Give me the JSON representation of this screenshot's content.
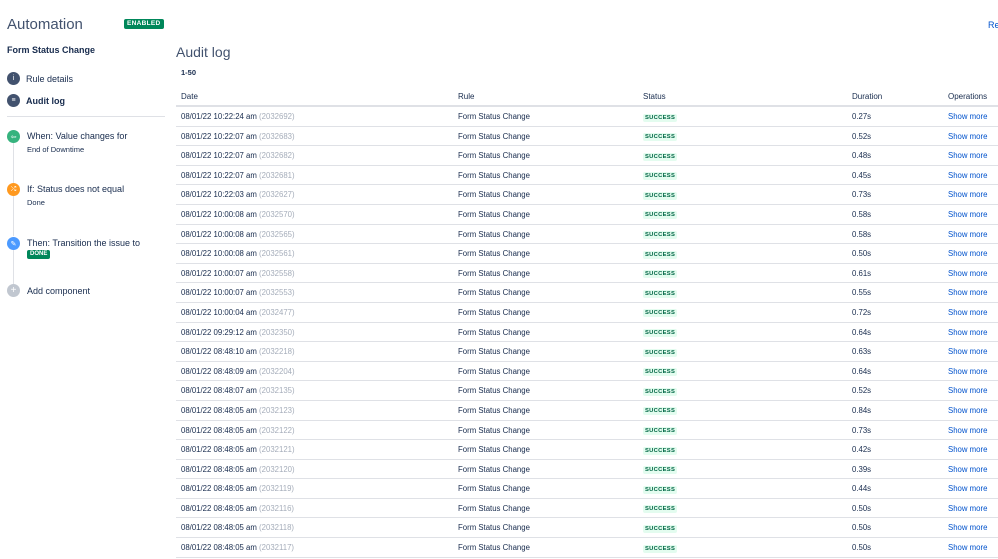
{
  "header": {
    "title": "Automation",
    "status_badge": "ENABLED",
    "right_link": "Re"
  },
  "rule_name": "Form Status Change",
  "nav": [
    {
      "label": "Rule details",
      "icon": "info-icon"
    },
    {
      "label": "Audit log",
      "icon": "audit-log-icon"
    }
  ],
  "components": [
    {
      "title": "When: Value changes for",
      "sub": "End of Downtime",
      "icon": "trigger-icon",
      "color": "#36b37e"
    },
    {
      "title": "If: Status does not equal",
      "sub": "Done",
      "icon": "condition-icon",
      "color": "#ff991f"
    },
    {
      "title": "Then: Transition the issue to",
      "badge": "DONE",
      "icon": "action-icon",
      "color": "#4c9aff"
    }
  ],
  "add_component": "Add component",
  "audit": {
    "title": "Audit log",
    "range": "1-50",
    "columns": {
      "date": "Date",
      "rule": "Rule",
      "status": "Status",
      "duration": "Duration",
      "operations": "Operations"
    },
    "rows": [
      {
        "date": "08/01/22 10:22:24 am",
        "id": "(2032692)",
        "rule": "Form Status Change",
        "status": "SUCCESS",
        "duration": "0.27s",
        "op": "Show more"
      },
      {
        "date": "08/01/22 10:22:07 am",
        "id": "(2032683)",
        "rule": "Form Status Change",
        "status": "SUCCESS",
        "duration": "0.52s",
        "op": "Show more"
      },
      {
        "date": "08/01/22 10:22:07 am",
        "id": "(2032682)",
        "rule": "Form Status Change",
        "status": "SUCCESS",
        "duration": "0.48s",
        "op": "Show more"
      },
      {
        "date": "08/01/22 10:22:07 am",
        "id": "(2032681)",
        "rule": "Form Status Change",
        "status": "SUCCESS",
        "duration": "0.45s",
        "op": "Show more"
      },
      {
        "date": "08/01/22 10:22:03 am",
        "id": "(2032627)",
        "rule": "Form Status Change",
        "status": "SUCCESS",
        "duration": "0.73s",
        "op": "Show more"
      },
      {
        "date": "08/01/22 10:00:08 am",
        "id": "(2032570)",
        "rule": "Form Status Change",
        "status": "SUCCESS",
        "duration": "0.58s",
        "op": "Show more"
      },
      {
        "date": "08/01/22 10:00:08 am",
        "id": "(2032565)",
        "rule": "Form Status Change",
        "status": "SUCCESS",
        "duration": "0.58s",
        "op": "Show more"
      },
      {
        "date": "08/01/22 10:00:08 am",
        "id": "(2032561)",
        "rule": "Form Status Change",
        "status": "SUCCESS",
        "duration": "0.50s",
        "op": "Show more"
      },
      {
        "date": "08/01/22 10:00:07 am",
        "id": "(2032558)",
        "rule": "Form Status Change",
        "status": "SUCCESS",
        "duration": "0.61s",
        "op": "Show more"
      },
      {
        "date": "08/01/22 10:00:07 am",
        "id": "(2032553)",
        "rule": "Form Status Change",
        "status": "SUCCESS",
        "duration": "0.55s",
        "op": "Show more"
      },
      {
        "date": "08/01/22 10:00:04 am",
        "id": "(2032477)",
        "rule": "Form Status Change",
        "status": "SUCCESS",
        "duration": "0.72s",
        "op": "Show more"
      },
      {
        "date": "08/01/22 09:29:12 am",
        "id": "(2032350)",
        "rule": "Form Status Change",
        "status": "SUCCESS",
        "duration": "0.64s",
        "op": "Show more"
      },
      {
        "date": "08/01/22 08:48:10 am",
        "id": "(2032218)",
        "rule": "Form Status Change",
        "status": "SUCCESS",
        "duration": "0.63s",
        "op": "Show more"
      },
      {
        "date": "08/01/22 08:48:09 am",
        "id": "(2032204)",
        "rule": "Form Status Change",
        "status": "SUCCESS",
        "duration": "0.64s",
        "op": "Show more"
      },
      {
        "date": "08/01/22 08:48:07 am",
        "id": "(2032135)",
        "rule": "Form Status Change",
        "status": "SUCCESS",
        "duration": "0.52s",
        "op": "Show more"
      },
      {
        "date": "08/01/22 08:48:05 am",
        "id": "(2032123)",
        "rule": "Form Status Change",
        "status": "SUCCESS",
        "duration": "0.84s",
        "op": "Show more"
      },
      {
        "date": "08/01/22 08:48:05 am",
        "id": "(2032122)",
        "rule": "Form Status Change",
        "status": "SUCCESS",
        "duration": "0.73s",
        "op": "Show more"
      },
      {
        "date": "08/01/22 08:48:05 am",
        "id": "(2032121)",
        "rule": "Form Status Change",
        "status": "SUCCESS",
        "duration": "0.42s",
        "op": "Show more"
      },
      {
        "date": "08/01/22 08:48:05 am",
        "id": "(2032120)",
        "rule": "Form Status Change",
        "status": "SUCCESS",
        "duration": "0.39s",
        "op": "Show more"
      },
      {
        "date": "08/01/22 08:48:05 am",
        "id": "(2032119)",
        "rule": "Form Status Change",
        "status": "SUCCESS",
        "duration": "0.44s",
        "op": "Show more"
      },
      {
        "date": "08/01/22 08:48:05 am",
        "id": "(2032116)",
        "rule": "Form Status Change",
        "status": "SUCCESS",
        "duration": "0.50s",
        "op": "Show more"
      },
      {
        "date": "08/01/22 08:48:05 am",
        "id": "(2032118)",
        "rule": "Form Status Change",
        "status": "SUCCESS",
        "duration": "0.50s",
        "op": "Show more"
      },
      {
        "date": "08/01/22 08:48:05 am",
        "id": "(2032117)",
        "rule": "Form Status Change",
        "status": "SUCCESS",
        "duration": "0.50s",
        "op": "Show more"
      }
    ]
  }
}
